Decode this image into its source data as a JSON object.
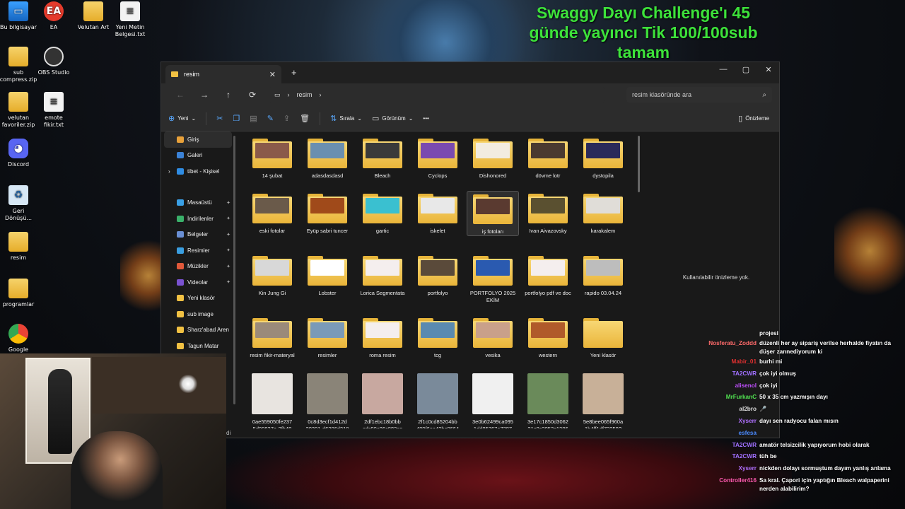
{
  "desktop": {
    "icons": [
      {
        "label": "Bu bilgisayar",
        "icon": "computer-icon"
      },
      {
        "label": "EA",
        "icon": "ea-icon"
      },
      {
        "label": "Velutan Art",
        "icon": "folder-icon"
      },
      {
        "label": "Yeni Metin Belgesi.txt",
        "icon": "text-file-icon"
      },
      {
        "label": "sub compress.zip",
        "icon": "zip-folder-icon"
      },
      {
        "label": "OBS Studio",
        "icon": "obs-icon"
      },
      {
        "label": "velutan favoriler.zip",
        "icon": "zip-folder-icon"
      },
      {
        "label": "emote fikir.txt",
        "icon": "text-file-icon"
      },
      {
        "label": "Discord",
        "icon": "discord-icon"
      },
      {
        "label": "Geri Dönüşü...",
        "icon": "recycle-bin-icon"
      },
      {
        "label": "resim",
        "icon": "folder-icon"
      },
      {
        "label": "programlar",
        "icon": "folder-icon"
      },
      {
        "label": "Google Chrome",
        "icon": "chrome-icon"
      }
    ],
    "headline": "Swaggy Dayı Challenge'ı 45 günde yayıncı Tik 100/100sub tamam"
  },
  "explorer": {
    "tab_title": "resim",
    "address": {
      "root_icon": "monitor-icon",
      "crumb": "resim"
    },
    "search_placeholder": "resim klasöründe ara",
    "toolbar": {
      "new_label": "Yeni",
      "sort_label": "Sırala",
      "view_label": "Görünüm",
      "more_label": "•••",
      "preview_label": "Önizleme"
    },
    "sidebar": {
      "items": [
        {
          "label": "Giriş",
          "icon": "home-icon",
          "color": "#e8a13a",
          "pinned": false
        },
        {
          "label": "Galeri",
          "icon": "gallery-icon",
          "color": "#3b82d6",
          "pinned": false
        },
        {
          "label": "tibet - Kişisel",
          "icon": "onedrive-icon",
          "color": "#2f8de4",
          "pinned": false
        },
        {
          "label": "Masaüstü",
          "icon": "desktop-icon",
          "color": "#3aa0e6",
          "pinned": true
        },
        {
          "label": "İndirilenler",
          "icon": "download-icon",
          "color": "#3ab06a",
          "pinned": true
        },
        {
          "label": "Belgeler",
          "icon": "documents-icon",
          "color": "#6a8fd4",
          "pinned": true
        },
        {
          "label": "Resimler",
          "icon": "pictures-icon",
          "color": "#3a9ee0",
          "pinned": true
        },
        {
          "label": "Müzikler",
          "icon": "music-icon",
          "color": "#e0583a",
          "pinned": true
        },
        {
          "label": "Videolar",
          "icon": "videos-icon",
          "color": "#7a52d0",
          "pinned": true
        },
        {
          "label": "Yeni klasör",
          "icon": "folder-icon",
          "color": "#f1c143",
          "pinned": false
        },
        {
          "label": "sub image",
          "icon": "folder-icon",
          "color": "#f1c143",
          "pinned": false
        },
        {
          "label": "Sharz'abad Aren",
          "icon": "folder-icon",
          "color": "#f1c143",
          "pinned": false
        },
        {
          "label": "Tagun Matar",
          "icon": "folder-icon",
          "color": "#f1c143",
          "pinned": false
        }
      ]
    },
    "files": [
      {
        "name": "14 şubat",
        "kind": "folder",
        "preview": "#8a5a4a"
      },
      {
        "name": "adasdasdasd",
        "kind": "folder",
        "preview": "#6a8fb0"
      },
      {
        "name": "Bleach",
        "kind": "folder",
        "preview": "#3a3a3a"
      },
      {
        "name": "Cyclops",
        "kind": "folder",
        "preview": "#7a4ab0"
      },
      {
        "name": "Dishonored",
        "kind": "folder",
        "preview": "#f2ece0"
      },
      {
        "name": "dövme lotr",
        "kind": "folder",
        "preview": "#4a3a30"
      },
      {
        "name": "dystopila",
        "kind": "folder",
        "preview": "#2a2a5a"
      },
      {
        "name": "eski fotolar",
        "kind": "folder",
        "preview": "#6a5a4a"
      },
      {
        "name": "Eyüp sabri tuncer",
        "kind": "folder",
        "preview": "#a04a1a"
      },
      {
        "name": "gartic",
        "kind": "folder",
        "preview": "#3ac0d0"
      },
      {
        "name": "iskelet",
        "kind": "folder",
        "preview": "#e8e8e8"
      },
      {
        "name": "iş fotoları",
        "kind": "folder",
        "preview": "#5a3a30",
        "selected": true
      },
      {
        "name": "Ivan Aivazovsky",
        "kind": "folder",
        "preview": "#5a5030"
      },
      {
        "name": "karakalem",
        "kind": "folder",
        "preview": "#e0ddd8"
      },
      {
        "name": "Kin Jung Gi",
        "kind": "folder",
        "preview": "#d8d8d8"
      },
      {
        "name": "Lobster",
        "kind": "folder",
        "preview": "#ffffff"
      },
      {
        "name": "Lorica Segmentata",
        "kind": "folder",
        "preview": "#f4eeee"
      },
      {
        "name": "portfolyo",
        "kind": "folder",
        "preview": "#5a4a3a"
      },
      {
        "name": "PORTFOLYO 2025 EKİM",
        "kind": "folder",
        "preview": "#2a5ab0"
      },
      {
        "name": "portfolyo pdf ve doc",
        "kind": "folder",
        "preview": "#f4eeee"
      },
      {
        "name": "rapido 03.04.24",
        "kind": "folder",
        "preview": "#bdbdbd"
      },
      {
        "name": "resim fikir-materyal",
        "kind": "folder",
        "preview": "#9a8a7a"
      },
      {
        "name": "resimler",
        "kind": "folder",
        "preview": "#7a9ab8"
      },
      {
        "name": "roma resim",
        "kind": "folder",
        "preview": "#f4eeee"
      },
      {
        "name": "tcg",
        "kind": "folder",
        "preview": "#5a8ab0"
      },
      {
        "name": "vesika",
        "kind": "folder",
        "preview": "#c9a08a"
      },
      {
        "name": "western",
        "kind": "folder",
        "preview": "#b05a2a"
      },
      {
        "name": "Yeni klasör",
        "kind": "folder",
        "preview": ""
      },
      {
        "name": "0ae559050fe237 5d90837a-2fb48",
        "kind": "image",
        "preview": "#e8e4e0"
      },
      {
        "name": "0c8d3ecf1d412d 20301-d6306d210",
        "kind": "image",
        "preview": "#8a8478"
      },
      {
        "name": "2df1ebc18b0bb cdc90c06c882ec",
        "kind": "image",
        "preview": "#c8a8a0"
      },
      {
        "name": "2f1c0cd85204bb 489f6ea42bc0664",
        "kind": "image",
        "preview": "#7a8a9a"
      },
      {
        "name": "3e0b62499ca095 1dd85367a7387",
        "kind": "image",
        "preview": "#f0f0f0"
      },
      {
        "name": "3e17c1850d3062 21c0c2053c1286",
        "kind": "image",
        "preview": "#6a8a5a"
      },
      {
        "name": "5e8bee065f960a 1b4ff1df73259?",
        "kind": "image",
        "preview": "#c8b098"
      }
    ],
    "preview_text": "Kullanılabilir önizleme yok.",
    "status": "di"
  },
  "chat": {
    "messages": [
      {
        "user": "",
        "color": "#ffffff",
        "text": "projesi"
      },
      {
        "user": "Nosferatu_Zoddd",
        "color": "#ff6a6a",
        "text": "düzenli her ay sipariş verilse herhalde fiyatın da düşer zannediyorum ki"
      },
      {
        "user": "Mabir_01",
        "color": "#e03030",
        "text": "burhi mi"
      },
      {
        "user": "TA2CWR",
        "color": "#a070ff",
        "text": "çok iyi olmuş"
      },
      {
        "user": "alisenol",
        "color": "#c050ff",
        "text": "çok iyi"
      },
      {
        "user": "MrFurkanC",
        "color": "#50e050",
        "text": "50 x 35 cm yazmışın dayı"
      },
      {
        "user": "al2bro",
        "color": "#dddddd",
        "text": "🎤"
      },
      {
        "user": "Xyserr",
        "color": "#b070ff",
        "text": "dayı sen radyocu falan mısın"
      },
      {
        "user": "esfesa",
        "color": "#4a8aff",
        "text": ""
      },
      {
        "user": "TA2CWR",
        "color": "#a070ff",
        "text": "amatör telsizcilik yapıyorum hobi olarak"
      },
      {
        "user": "TA2CWR",
        "color": "#a070ff",
        "text": "tüh be"
      },
      {
        "user": "Xyserr",
        "color": "#b070ff",
        "text": "nickden dolayı sormuştum dayım yanlış anlama"
      },
      {
        "user": "Controller416",
        "color": "#ff5ab0",
        "text": "Sa kral. Çapori için yaptığın Bleach walpaperini nerden alabilirim?"
      }
    ]
  }
}
